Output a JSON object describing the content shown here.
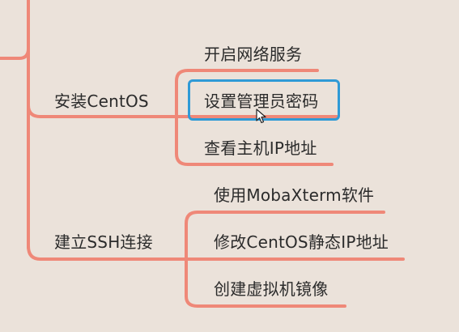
{
  "mindmap": {
    "branches": [
      {
        "label": "安装CentOS",
        "children": [
          "开启网络服务",
          "设置管理员密码",
          "查看主机IP地址"
        ]
      },
      {
        "label": "建立SSH连接",
        "children": [
          "使用MobaXterm软件",
          "修改CentOS静态IP地址",
          "创建虚拟机镜像"
        ]
      }
    ],
    "selected_node": "设置管理员密码"
  },
  "colors": {
    "background": "#ebe2da",
    "branch_line": "#ef8878",
    "selection_border": "#2f9ad6",
    "text": "#2b2b2b"
  }
}
